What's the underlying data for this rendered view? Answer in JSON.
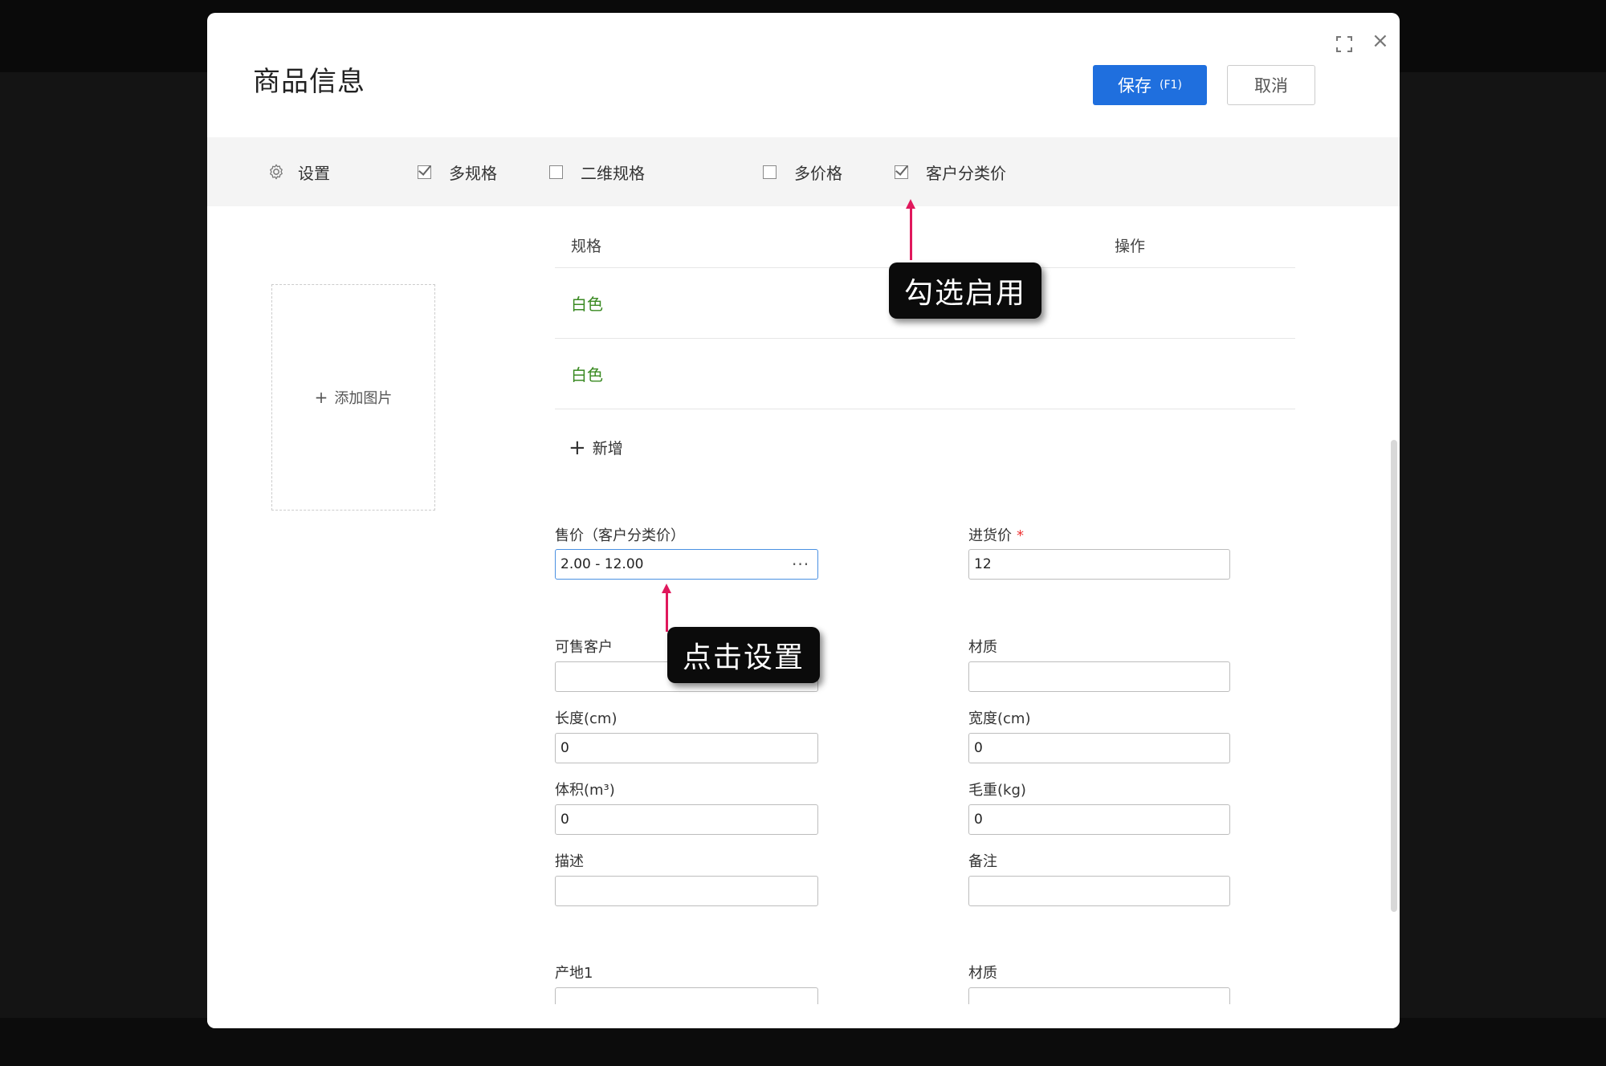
{
  "modal": {
    "title": "商品信息",
    "save_label": "保存",
    "save_shortcut": "(F1)",
    "cancel_label": "取消"
  },
  "settings": {
    "label": "设置",
    "options": [
      {
        "label": "多规格",
        "checked": true
      },
      {
        "label": "二维规格",
        "checked": false
      },
      {
        "label": "多价格",
        "checked": false
      },
      {
        "label": "客户分类价",
        "checked": true
      }
    ]
  },
  "image_upload": {
    "label": "添加图片"
  },
  "spec_table": {
    "headers": [
      "规格",
      "操作"
    ],
    "rows": [
      "白色",
      "白色"
    ],
    "add_label": "新增"
  },
  "form": {
    "sale_price": {
      "label": "售价（客户分类价）",
      "value": "2.00 - 12.00"
    },
    "purchase_price": {
      "label": "进货价",
      "required_mark": "*",
      "value": "12"
    },
    "customers": {
      "label": "可售客户",
      "value": ""
    },
    "material": {
      "label": "材质",
      "value": ""
    },
    "length": {
      "label": "长度(cm)",
      "value": "0"
    },
    "width": {
      "label": "宽度(cm)",
      "value": "0"
    },
    "volume": {
      "label": "体积(m³)",
      "value": "0"
    },
    "gross_weight": {
      "label": "毛重(kg)",
      "value": "0"
    },
    "description": {
      "label": "描述",
      "value": ""
    },
    "remark": {
      "label": "备注",
      "value": ""
    },
    "origin": {
      "label": "产地1",
      "value": ""
    },
    "material2": {
      "label": "材质",
      "value": ""
    }
  },
  "annotations": {
    "enable_tip": "勾选启用",
    "click_tip": "点击设置",
    "arrow_color": "#e0185c"
  },
  "colors": {
    "primary": "#1f6fde",
    "spec_text": "#3a8a22",
    "required": "#e33333"
  }
}
